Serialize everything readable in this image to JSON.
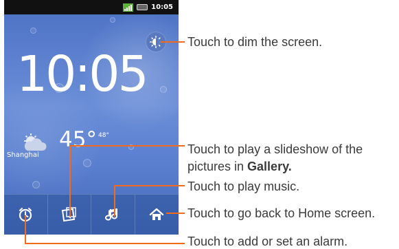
{
  "phone": {
    "status_time": "10:05",
    "clock_time": "10:05",
    "weather": {
      "temperature": "45°",
      "high": "48°",
      "location": "Shanghai"
    },
    "icons": {
      "dim": "brightness-icon",
      "alarm": "alarm-clock-icon",
      "gallery": "gallery-icon",
      "music": "music-note-icon",
      "home": "home-icon",
      "weather": "partly-cloudy-icon",
      "signal": "signal-icon",
      "battery": "battery-icon"
    }
  },
  "annotations": {
    "dim": "Touch to dim the screen.",
    "slideshow_line1": "Touch to play a slideshow of the",
    "slideshow_line2_prefix": "pictures in ",
    "slideshow_line2_bold": "Gallery.",
    "music": "Touch to play music.",
    "home": "Touch to go back to Home screen.",
    "alarm": "Touch to add or set an alarm."
  },
  "colors": {
    "accent": "#f26b1d",
    "screen": "#5a7fcf",
    "text": "#3a3a3a"
  }
}
